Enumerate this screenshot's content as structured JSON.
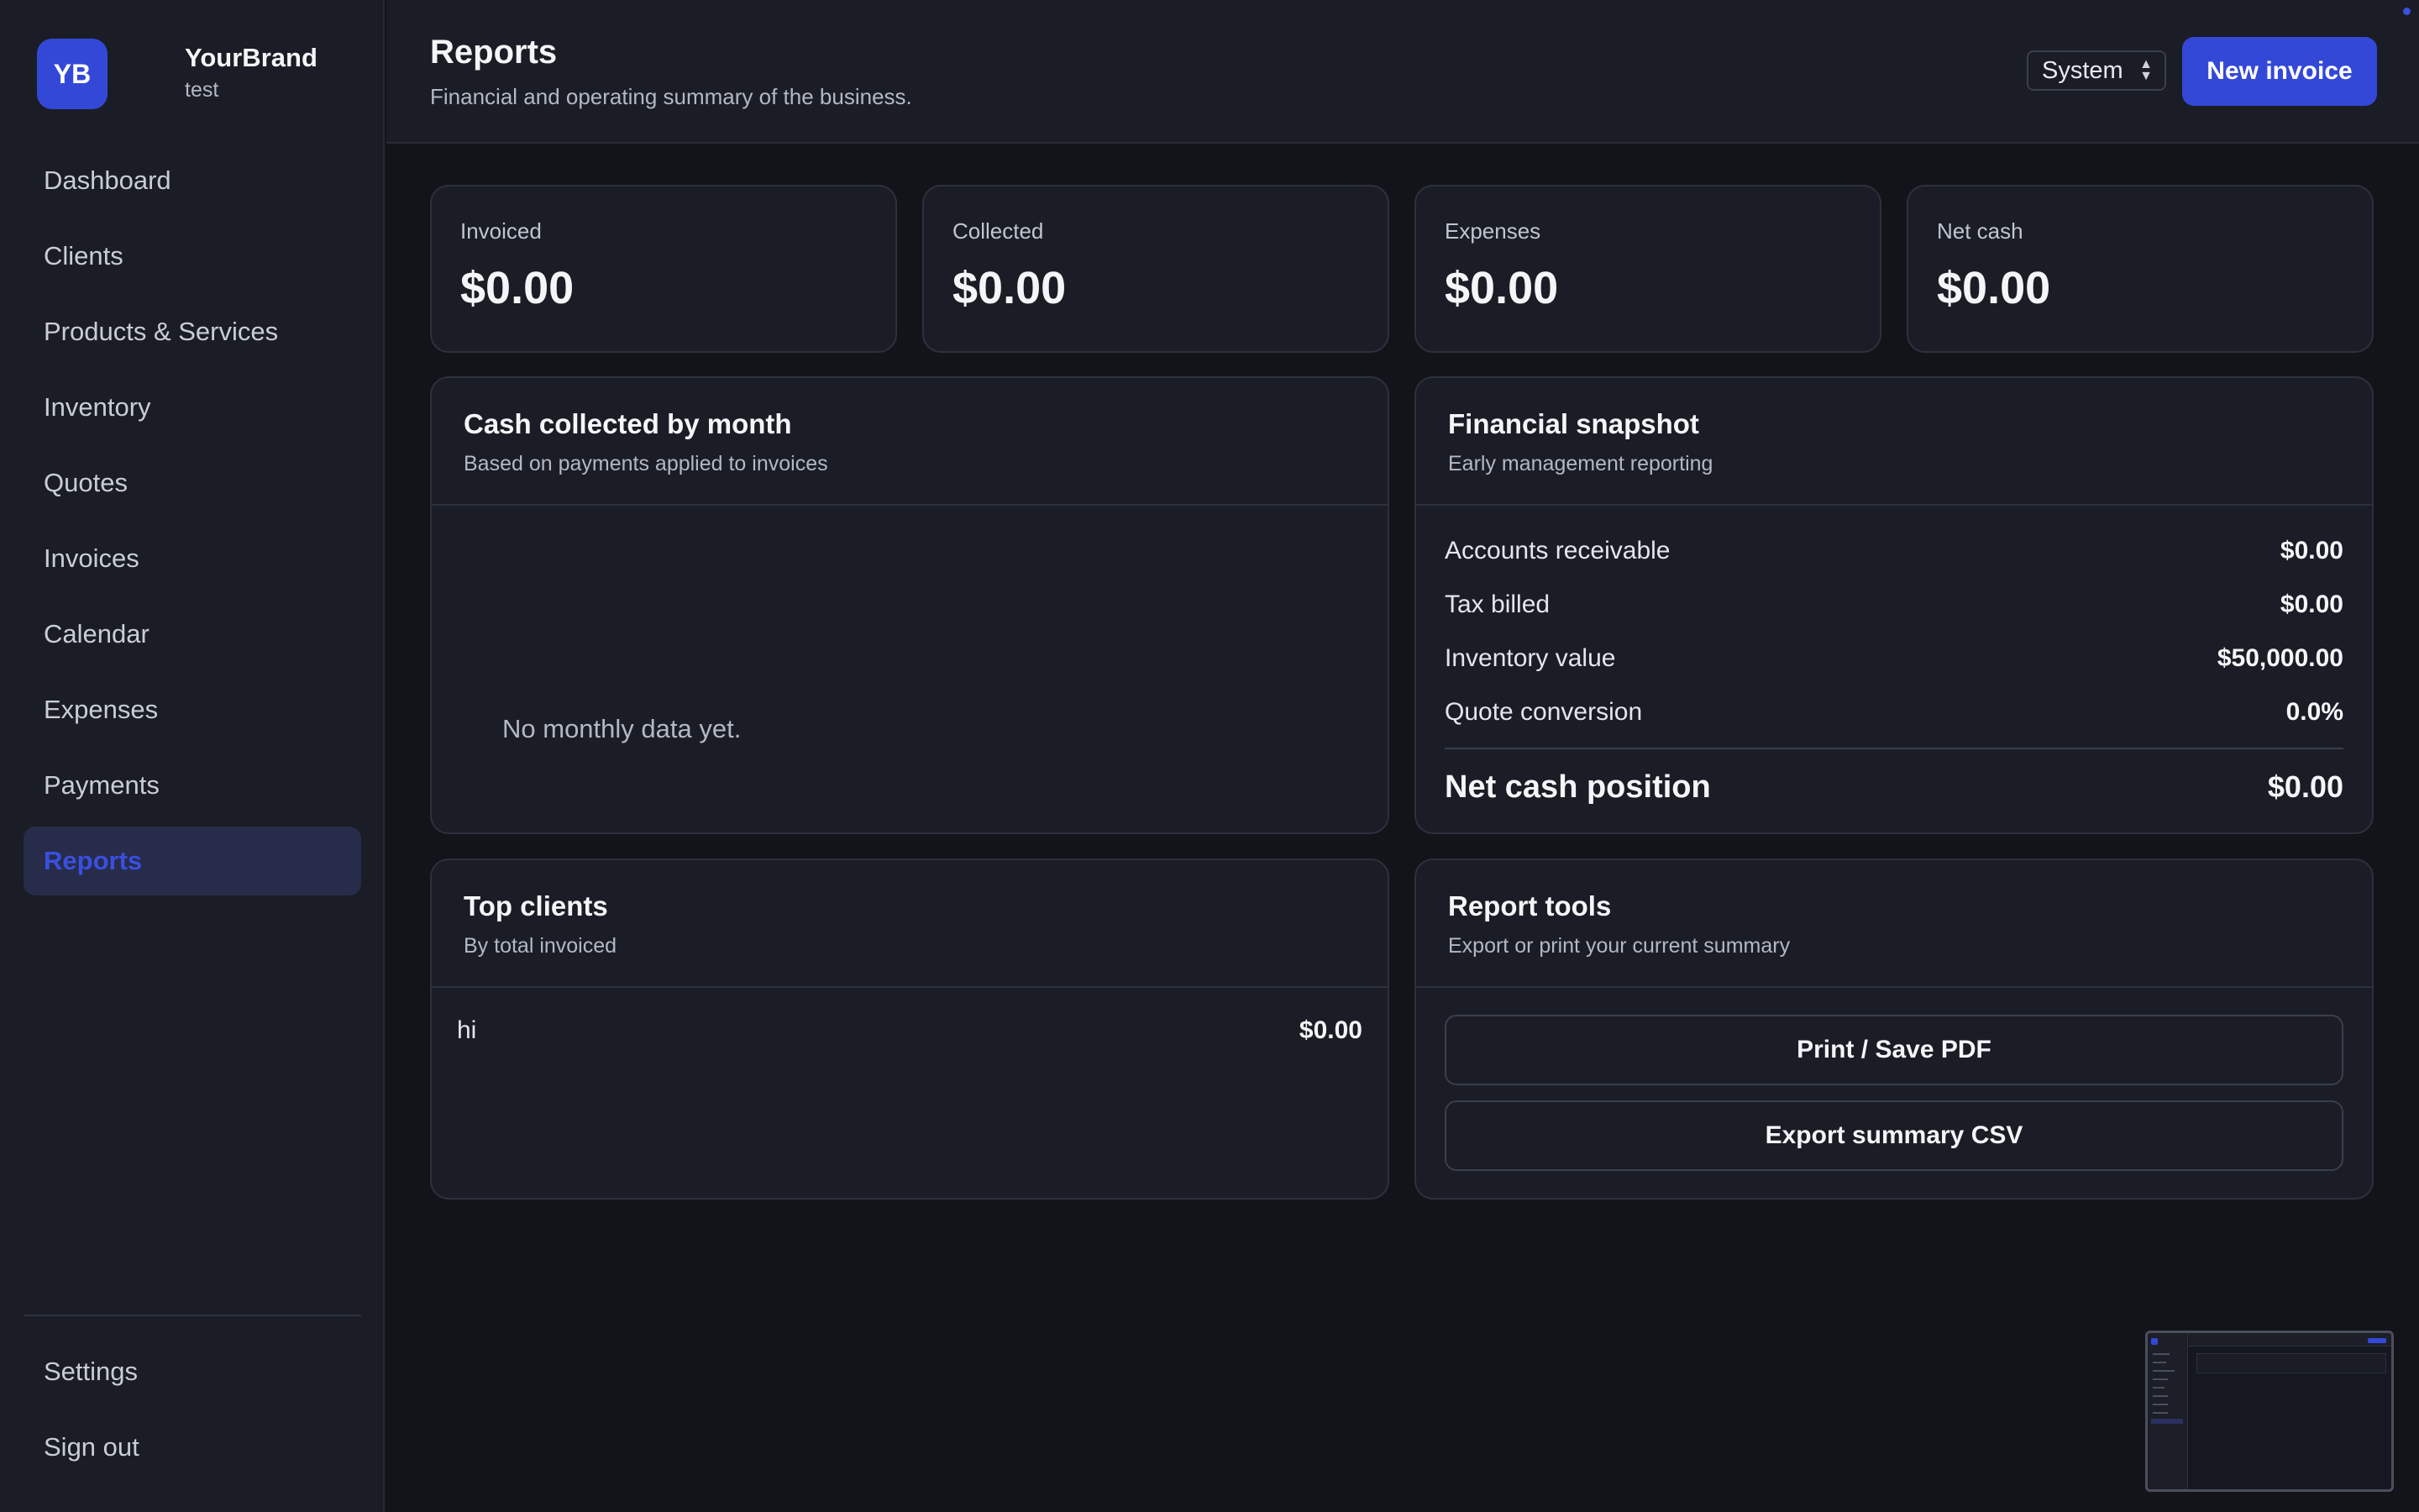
{
  "brand": {
    "initials": "YB",
    "name": "YourBrand",
    "subtitle": "test"
  },
  "sidebar": {
    "items": [
      {
        "label": "Dashboard",
        "active": false
      },
      {
        "label": "Clients",
        "active": false
      },
      {
        "label": "Products & Services",
        "active": false
      },
      {
        "label": "Inventory",
        "active": false
      },
      {
        "label": "Quotes",
        "active": false
      },
      {
        "label": "Invoices",
        "active": false
      },
      {
        "label": "Calendar",
        "active": false
      },
      {
        "label": "Expenses",
        "active": false
      },
      {
        "label": "Payments",
        "active": false
      },
      {
        "label": "Reports",
        "active": true
      }
    ],
    "bottom": [
      {
        "label": "Settings"
      },
      {
        "label": "Sign out"
      }
    ]
  },
  "header": {
    "title": "Reports",
    "subtitle": "Financial and operating summary of the business.",
    "theme_select": "System",
    "new_invoice_label": "New invoice"
  },
  "stats": [
    {
      "label": "Invoiced",
      "value": "$0.00"
    },
    {
      "label": "Collected",
      "value": "$0.00"
    },
    {
      "label": "Expenses",
      "value": "$0.00"
    },
    {
      "label": "Net cash",
      "value": "$0.00"
    }
  ],
  "cash_by_month": {
    "title": "Cash collected by month",
    "subtitle": "Based on payments applied to invoices",
    "empty_message": "No monthly data yet."
  },
  "snapshot": {
    "title": "Financial snapshot",
    "subtitle": "Early management reporting",
    "rows": [
      {
        "label": "Accounts receivable",
        "value": "$0.00"
      },
      {
        "label": "Tax billed",
        "value": "$0.00"
      },
      {
        "label": "Inventory value",
        "value": "$50,000.00"
      },
      {
        "label": "Quote conversion",
        "value": "0.0%"
      }
    ],
    "total": {
      "label": "Net cash position",
      "value": "$0.00"
    }
  },
  "top_clients": {
    "title": "Top clients",
    "subtitle": "By total invoiced",
    "rows": [
      {
        "name": "hi",
        "amount": "$0.00"
      }
    ]
  },
  "report_tools": {
    "title": "Report tools",
    "subtitle": "Export or print your current summary",
    "print_label": "Print / Save PDF",
    "export_label": "Export summary CSV"
  },
  "colors": {
    "accent": "#3448d8",
    "background": "#12141a",
    "surface": "#1a1d25"
  }
}
